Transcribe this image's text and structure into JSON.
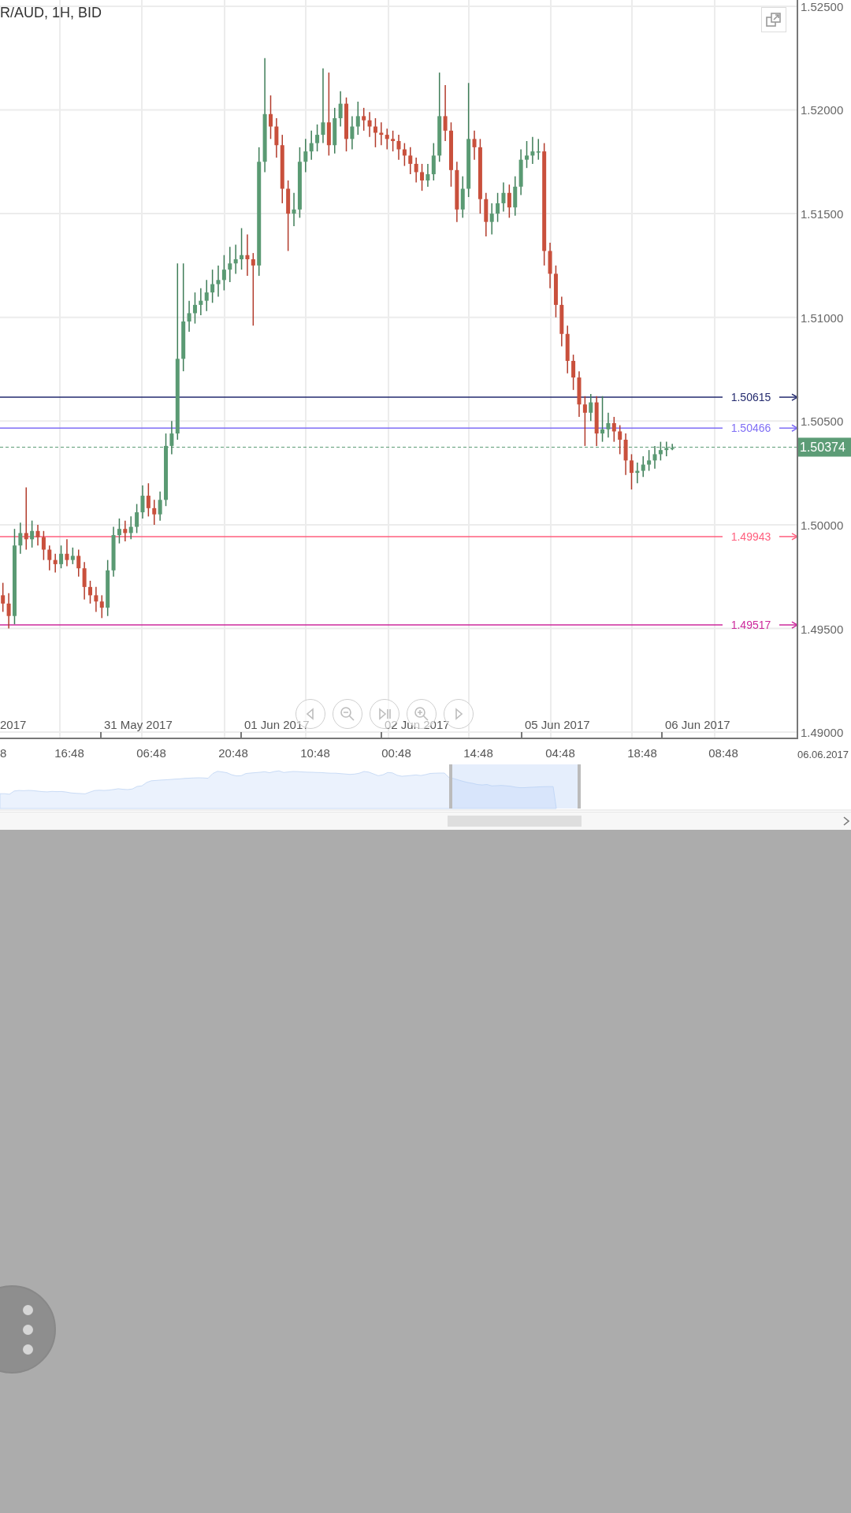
{
  "chart": {
    "title": "R/AUD, 1H, BID",
    "chart_data": {
      "type": "candlestick",
      "yticks": [
        {
          "value": 1.525,
          "label": "1.52500"
        },
        {
          "value": 1.52,
          "label": "1.52000"
        },
        {
          "value": 1.515,
          "label": "1.51500"
        },
        {
          "value": 1.51,
          "label": "1.51000"
        },
        {
          "value": 1.505,
          "label": "1.50500"
        },
        {
          "value": 1.5,
          "label": "1.50000"
        },
        {
          "value": 1.495,
          "label": "1.49500"
        },
        {
          "value": 1.49,
          "label": "1.49000"
        }
      ],
      "ylim": [
        1.4897,
        1.5253
      ],
      "grid": true,
      "ref_lines": [
        {
          "axis": "y",
          "value": 1.50615,
          "label": "1.50615",
          "color": "#232a6e"
        },
        {
          "axis": "y",
          "value": 1.50466,
          "label": "1.50466",
          "color": "#7f6ef5"
        },
        {
          "axis": "y",
          "value": 1.50374,
          "label": "1.50374",
          "color": "#5c9c76"
        },
        {
          "axis": "y",
          "value": 1.49943,
          "label": "1.49943",
          "color": "#ff5f7e"
        },
        {
          "axis": "y",
          "value": 1.49517,
          "label": "1.49517",
          "color": "#cc2a9c"
        }
      ],
      "categories": [
        null,
        null,
        null,
        null,
        null,
        null,
        null,
        null,
        null,
        null,
        null,
        null,
        null,
        null,
        null,
        null,
        null,
        null,
        null,
        null,
        null,
        null,
        null,
        null,
        null,
        null,
        null,
        null,
        null,
        null,
        null,
        null,
        null,
        null,
        null,
        null,
        null,
        null,
        null,
        null,
        null,
        null,
        null,
        null,
        null,
        null,
        null,
        null,
        null,
        null,
        null,
        null,
        null,
        null,
        null,
        null,
        null,
        null,
        null,
        null,
        null,
        null,
        null,
        null,
        null,
        null,
        null,
        null,
        null,
        null,
        null,
        null,
        null,
        null,
        null,
        null,
        null,
        null,
        null,
        null,
        null,
        null,
        null,
        null,
        null,
        null,
        null,
        null,
        null,
        null,
        null,
        null,
        null,
        null,
        null,
        null,
        null,
        null,
        null,
        null,
        null,
        null,
        null,
        null,
        null,
        null,
        null,
        null,
        null,
        null,
        null,
        null,
        null,
        null,
        null,
        null,
        null,
        null,
        null,
        null,
        null,
        null,
        null,
        null,
        null,
        null,
        null,
        null,
        null,
        null,
        null,
        null,
        null,
        null,
        null,
        null,
        null
      ],
      "ohlc": [
        [
          1.4966,
          1.4972,
          1.4958,
          1.4962
        ],
        [
          1.4962,
          1.4967,
          1.495,
          1.4956
        ],
        [
          1.4956,
          1.4998,
          1.4952,
          1.499
        ],
        [
          1.499,
          1.5001,
          1.4986,
          1.4996
        ],
        [
          1.4996,
          1.5018,
          1.4988,
          1.4993
        ],
        [
          1.4993,
          1.5002,
          1.4989,
          1.4997
        ],
        [
          1.4997,
          1.5,
          1.499,
          1.4994
        ],
        [
          1.4994,
          1.4997,
          1.4983,
          1.4988
        ],
        [
          1.4988,
          1.499,
          1.4978,
          1.4983
        ],
        [
          1.4983,
          1.4986,
          1.4977,
          1.4981
        ],
        [
          1.4981,
          1.499,
          1.4979,
          1.4986
        ],
        [
          1.4986,
          1.4993,
          1.498,
          1.4983
        ],
        [
          1.4983,
          1.4989,
          1.4981,
          1.4985
        ],
        [
          1.4985,
          1.4988,
          1.4975,
          1.4979
        ],
        [
          1.4979,
          1.4982,
          1.4964,
          1.497
        ],
        [
          1.497,
          1.4973,
          1.4962,
          1.4966
        ],
        [
          1.4966,
          1.497,
          1.4958,
          1.4963
        ],
        [
          1.4963,
          1.4966,
          1.4955,
          1.496
        ],
        [
          1.496,
          1.4983,
          1.4956,
          1.4978
        ],
        [
          1.4978,
          1.4999,
          1.4975,
          1.4995
        ],
        [
          1.4995,
          1.5003,
          1.4991,
          1.4998
        ],
        [
          1.4998,
          1.5002,
          1.4992,
          1.4996
        ],
        [
          1.4996,
          1.5004,
          1.4993,
          1.4999
        ],
        [
          1.4999,
          1.501,
          1.4996,
          1.5006
        ],
        [
          1.5006,
          1.5019,
          1.5003,
          1.5014
        ],
        [
          1.5014,
          1.502,
          1.5004,
          1.5008
        ],
        [
          1.5008,
          1.5012,
          1.5,
          1.5005
        ],
        [
          1.5005,
          1.5016,
          1.5002,
          1.5012
        ],
        [
          1.5012,
          1.5044,
          1.5009,
          1.5038
        ],
        [
          1.5038,
          1.505,
          1.5034,
          1.5044
        ],
        [
          1.5044,
          1.5126,
          1.5041,
          1.508
        ],
        [
          1.508,
          1.5126,
          1.5074,
          1.5098
        ],
        [
          1.5098,
          1.5108,
          1.5093,
          1.5102
        ],
        [
          1.5102,
          1.5112,
          1.5097,
          1.5106
        ],
        [
          1.5106,
          1.5114,
          1.5101,
          1.5108
        ],
        [
          1.5108,
          1.5118,
          1.5103,
          1.5112
        ],
        [
          1.5112,
          1.5123,
          1.5107,
          1.5116
        ],
        [
          1.5116,
          1.5125,
          1.511,
          1.5118
        ],
        [
          1.5118,
          1.513,
          1.5113,
          1.5123
        ],
        [
          1.5123,
          1.5134,
          1.5117,
          1.5126
        ],
        [
          1.5126,
          1.5135,
          1.5121,
          1.5128
        ],
        [
          1.5128,
          1.5143,
          1.5123,
          1.513
        ],
        [
          1.513,
          1.514,
          1.512,
          1.5128
        ],
        [
          1.5128,
          1.5131,
          1.5096,
          1.5125
        ],
        [
          1.5125,
          1.5182,
          1.512,
          1.5175
        ],
        [
          1.5175,
          1.5225,
          1.517,
          1.5198
        ],
        [
          1.5198,
          1.5207,
          1.5186,
          1.5192
        ],
        [
          1.5192,
          1.5196,
          1.5177,
          1.5183
        ],
        [
          1.5183,
          1.5188,
          1.5155,
          1.5162
        ],
        [
          1.5162,
          1.5166,
          1.5132,
          1.515
        ],
        [
          1.515,
          1.516,
          1.5144,
          1.5152
        ],
        [
          1.5152,
          1.5182,
          1.5148,
          1.5175
        ],
        [
          1.5175,
          1.5186,
          1.517,
          1.518
        ],
        [
          1.518,
          1.519,
          1.5176,
          1.5184
        ],
        [
          1.5184,
          1.5193,
          1.518,
          1.5188
        ],
        [
          1.5188,
          1.522,
          1.5184,
          1.5194
        ],
        [
          1.5194,
          1.5218,
          1.5178,
          1.5183
        ],
        [
          1.5183,
          1.5201,
          1.5179,
          1.5196
        ],
        [
          1.5196,
          1.5209,
          1.5192,
          1.5203
        ],
        [
          1.5203,
          1.5206,
          1.518,
          1.5186
        ],
        [
          1.5186,
          1.5197,
          1.5181,
          1.5192
        ],
        [
          1.5192,
          1.5204,
          1.5188,
          1.5197
        ],
        [
          1.5197,
          1.5201,
          1.519,
          1.5195
        ],
        [
          1.5195,
          1.5199,
          1.5187,
          1.5192
        ],
        [
          1.5192,
          1.5196,
          1.5182,
          1.5189
        ],
        [
          1.5189,
          1.5194,
          1.5183,
          1.5188
        ],
        [
          1.5188,
          1.5191,
          1.5181,
          1.5186
        ],
        [
          1.5186,
          1.519,
          1.518,
          1.5185
        ],
        [
          1.5185,
          1.5188,
          1.5176,
          1.5181
        ],
        [
          1.5181,
          1.5184,
          1.5173,
          1.5178
        ],
        [
          1.5178,
          1.5182,
          1.5169,
          1.5174
        ],
        [
          1.5174,
          1.5177,
          1.5165,
          1.517
        ],
        [
          1.517,
          1.5174,
          1.5161,
          1.5166
        ],
        [
          1.5166,
          1.5174,
          1.5163,
          1.5169
        ],
        [
          1.5169,
          1.5184,
          1.5166,
          1.5178
        ],
        [
          1.5178,
          1.5218,
          1.5175,
          1.5197
        ],
        [
          1.5197,
          1.5212,
          1.5185,
          1.519
        ],
        [
          1.519,
          1.5194,
          1.5163,
          1.5171
        ],
        [
          1.5171,
          1.5175,
          1.5146,
          1.5152
        ],
        [
          1.5152,
          1.5168,
          1.5148,
          1.5162
        ],
        [
          1.5162,
          1.5213,
          1.5158,
          1.5186
        ],
        [
          1.5186,
          1.519,
          1.5176,
          1.5182
        ],
        [
          1.5182,
          1.5186,
          1.515,
          1.5157
        ],
        [
          1.5157,
          1.516,
          1.5139,
          1.5146
        ],
        [
          1.5146,
          1.5155,
          1.514,
          1.515
        ],
        [
          1.515,
          1.516,
          1.5146,
          1.5155
        ],
        [
          1.5155,
          1.5165,
          1.5151,
          1.516
        ],
        [
          1.516,
          1.5164,
          1.5148,
          1.5153
        ],
        [
          1.5153,
          1.5168,
          1.5149,
          1.5163
        ],
        [
          1.5163,
          1.5181,
          1.5159,
          1.5176
        ],
        [
          1.5176,
          1.5185,
          1.5172,
          1.5178
        ],
        [
          1.5178,
          1.5187,
          1.5174,
          1.518
        ],
        [
          1.518,
          1.5186,
          1.5176,
          1.518
        ],
        [
          1.518,
          1.5184,
          1.5125,
          1.5132
        ],
        [
          1.5132,
          1.5136,
          1.5114,
          1.5121
        ],
        [
          1.5121,
          1.5125,
          1.51,
          1.5106
        ],
        [
          1.5106,
          1.511,
          1.5086,
          1.5092
        ],
        [
          1.5092,
          1.5096,
          1.5073,
          1.5079
        ],
        [
          1.5079,
          1.5082,
          1.5065,
          1.5071
        ],
        [
          1.5071,
          1.5074,
          1.5052,
          1.5058
        ],
        [
          1.5058,
          1.5062,
          1.5038,
          1.5054
        ],
        [
          1.5054,
          1.5063,
          1.505,
          1.5059
        ],
        [
          1.5059,
          1.5062,
          1.5038,
          1.5044
        ],
        [
          1.5044,
          1.5062,
          1.504,
          1.5046
        ],
        [
          1.5046,
          1.5054,
          1.5042,
          1.5049
        ],
        [
          1.5049,
          1.5052,
          1.504,
          1.5045
        ],
        [
          1.5045,
          1.5048,
          1.5034,
          1.5041
        ],
        [
          1.5041,
          1.5044,
          1.5024,
          1.5031
        ],
        [
          1.5031,
          1.5034,
          1.5017,
          1.5025
        ],
        [
          1.5025,
          1.503,
          1.502,
          1.5026
        ],
        [
          1.5026,
          1.5033,
          1.5023,
          1.5029
        ],
        [
          1.5029,
          1.5036,
          1.5026,
          1.5031
        ],
        [
          1.5031,
          1.5038,
          1.5027,
          1.5034
        ],
        [
          1.5034,
          1.504,
          1.5031,
          1.5036
        ],
        [
          1.5036,
          1.504,
          1.5033,
          1.5037
        ],
        [
          1.5037,
          1.5039,
          1.5036,
          1.5037
        ],
        null,
        null,
        null,
        null,
        null,
        null,
        null,
        null,
        null,
        null,
        null,
        null,
        null,
        null,
        null,
        null,
        null,
        null,
        null,
        null,
        null
      ]
    },
    "date_labels": [
      "2017",
      "31 May 2017",
      "01 Jun 2017",
      "02 Jun 2017",
      "05 Jun 2017",
      "06 Jun 2017"
    ],
    "time_labels": [
      "8",
      "16:48",
      "06:48",
      "20:48",
      "10:48",
      "00:48",
      "14:48",
      "04:48",
      "18:48",
      "08:48"
    ],
    "axis_date": "06.06.2017"
  }
}
